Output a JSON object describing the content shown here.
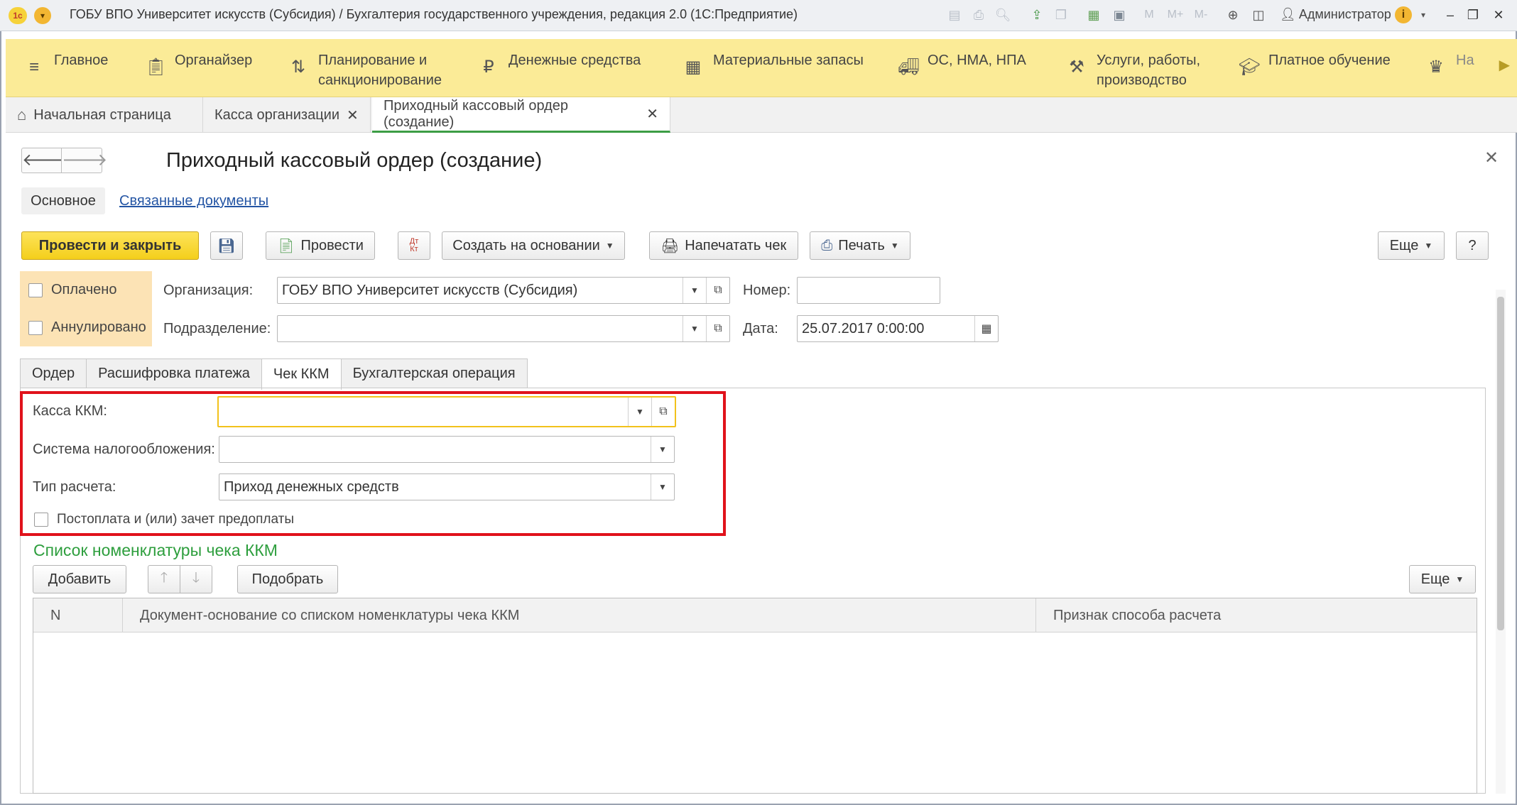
{
  "window": {
    "title": "ГОБУ ВПО Университет искусств (Субсидия) / Бухгалтерия государственного учреждения, редакция 2.0  (1С:Предприятие)",
    "user": "Администратор",
    "toolbar_letters": [
      "M",
      "M+",
      "M-"
    ]
  },
  "sections": [
    {
      "label": "Главное",
      "icon": "menu-icon"
    },
    {
      "label": "Органайзер",
      "icon": "clipboard-icon"
    },
    {
      "label": "Планирование и\nсанкционирование",
      "icon": "planning-icon"
    },
    {
      "label": "Денежные средства",
      "icon": "ruble-icon"
    },
    {
      "label": "Материальные запасы",
      "icon": "grid-icon"
    },
    {
      "label": "ОС, НМА, НПА",
      "icon": "truck-icon"
    },
    {
      "label": "Услуги, работы,\nпроизводство",
      "icon": "tools-icon"
    },
    {
      "label": "Платное обучение",
      "icon": "graduation-icon"
    },
    {
      "label": "На",
      "icon": "eagle-icon"
    }
  ],
  "open_tabs": [
    {
      "label": "Начальная страница",
      "closable": false
    },
    {
      "label": "Касса организации",
      "closable": true
    },
    {
      "label": "Приходный кассовый ордер (создание)",
      "closable": true,
      "active": true
    }
  ],
  "form": {
    "title": "Приходный кассовый ордер (создание)",
    "tab_main": "Основное",
    "tab_related": "Связанные документы",
    "buttons": {
      "post_close": "Провести и закрыть",
      "post": "Провести",
      "dt_kt": "Дт\nКт",
      "create_based": "Создать на основании",
      "print_check": "Напечатать чек",
      "print": "Печать",
      "more": "Еще",
      "help": "?"
    },
    "status": {
      "paid": "Оплачено",
      "cancelled": "Аннулировано"
    },
    "organization_label": "Организация:",
    "organization_value": "ГОБУ ВПО Университет искусств (Субсидия)",
    "division_label": "Подразделение:",
    "division_value": "",
    "number_label": "Номер:",
    "number_value": "",
    "date_label": "Дата:",
    "date_value": "25.07.2017  0:00:00",
    "inner_tabs": [
      "Ордер",
      "Расшифровка платежа",
      "Чек ККМ",
      "Бухгалтерская операция"
    ],
    "active_inner_tab": "Чек ККМ",
    "kkm": {
      "register_label": "Касса ККМ:",
      "register_value": "",
      "tax_label": "Система налогообложения:",
      "tax_value": "",
      "calc_type_label": "Тип расчета:",
      "calc_type_value": "Приход денежных средств",
      "postpay_label": "Постоплата и (или) зачет предоплаты"
    },
    "list": {
      "title": "Список номенклатуры чека ККМ",
      "add": "Добавить",
      "pick": "Подобрать",
      "more": "Еще",
      "columns": [
        "N",
        "Документ-основание со списком номенклатуры чека ККМ",
        "Признак способа расчета"
      ]
    }
  },
  "colors": {
    "accent_yellow": "#f4cf1b",
    "section_bar": "#fbeb97",
    "highlight_red": "#e0121b",
    "section_title_green": "#2d9e3d"
  }
}
